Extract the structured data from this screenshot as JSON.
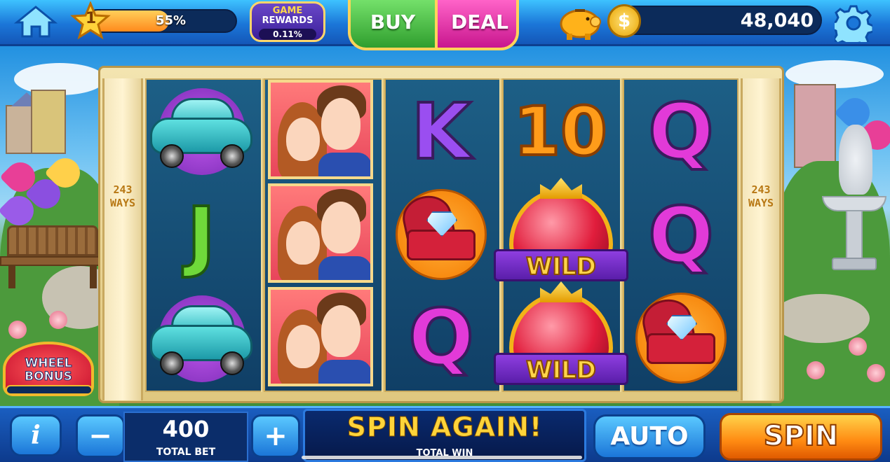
{
  "top_bar": {
    "home_icon": "home-icon",
    "level": "1",
    "xp_progress_label": "55%",
    "xp_progress": 0.55,
    "game_rewards": {
      "line1": "GAME",
      "line2": "REWARDS",
      "percent": "0.11%"
    },
    "buy_label": "BUY",
    "deal_label": "DEAL",
    "piggy_icon": "piggy-bank-icon",
    "coin_icon_glyph": "$",
    "coin_balance": "48,040",
    "settings_icon": "gear-icon"
  },
  "reels": {
    "ways_label": "243\nWAYS",
    "columns": [
      [
        "car",
        "J",
        "car"
      ],
      [
        "couple",
        "couple",
        "couple"
      ],
      [
        "K",
        "ring",
        "Q"
      ],
      [
        "10",
        "wild",
        "wild"
      ],
      [
        "Q",
        "Q",
        "ring"
      ]
    ],
    "wild_label": "WILD",
    "letter_colors": {
      "J": "#6fd93a",
      "K": "#9a4ef0",
      "Q": "#e23ad8",
      "10": "#ff9c1a"
    }
  },
  "wheel_bonus": {
    "line1": "WHEEL",
    "line2": "BONUS"
  },
  "bottom_bar": {
    "info_label": "i",
    "minus_label": "−",
    "total_bet_value": "400",
    "total_bet_label": "TOTAL BET",
    "plus_label": "+",
    "win_message": "SPIN AGAIN!",
    "total_win_label": "TOTAL WIN",
    "auto_label": "AUTO",
    "spin_label": "SPIN"
  },
  "colors": {
    "accent_blue": "#1b76d8",
    "buy_green": "#2f9e2e",
    "deal_pink": "#c8168e",
    "spin_orange": "#ff8a12",
    "gold": "#ffd43a"
  }
}
